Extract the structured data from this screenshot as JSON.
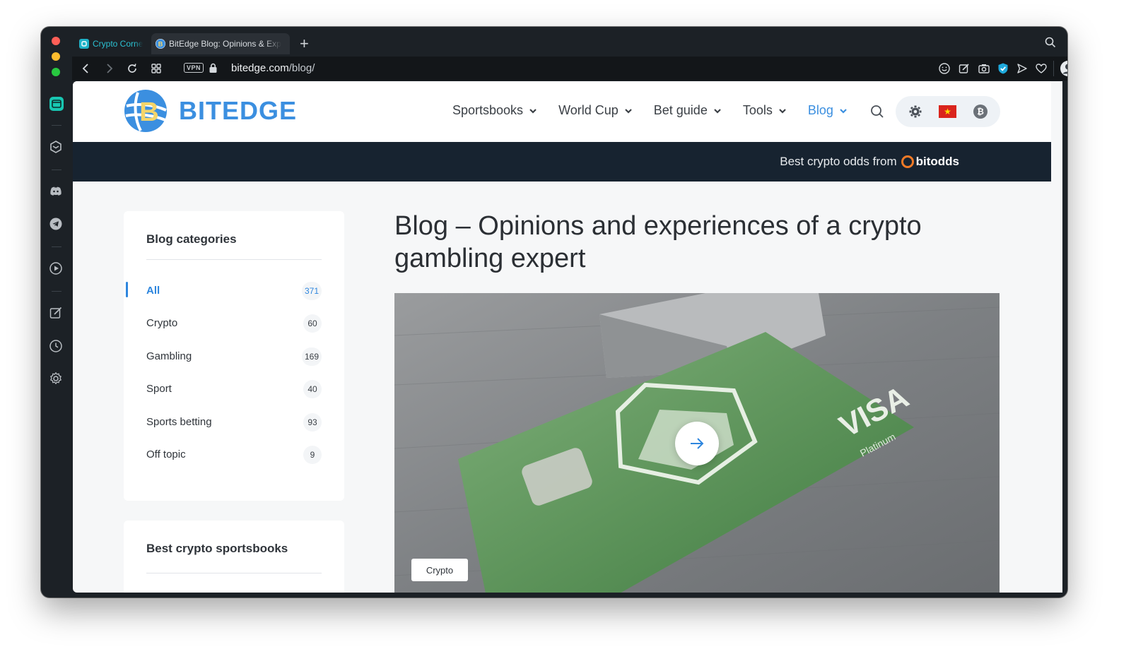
{
  "browser": {
    "tabs": [
      {
        "title": "Crypto Corne",
        "active": false
      },
      {
        "title": "BitEdge Blog: Opinions & Exp",
        "active": true
      }
    ],
    "new_tab": "+",
    "vpn_badge": "VPN",
    "url_host": "bitedge.com",
    "url_path": "/blog/",
    "sidebar_more": "•••"
  },
  "site": {
    "logo_text": "BITEDGE",
    "nav": [
      "Sportsbooks",
      "World Cup",
      "Bet guide",
      "Tools",
      "Blog"
    ],
    "active_nav": "Blog",
    "flag": "★",
    "btc": "₿",
    "promo_text": "Best crypto odds from",
    "promo_brand": "bitodds",
    "accent": "#3b8fe0",
    "promo_bg": "#172330"
  },
  "categories": {
    "title": "Blog categories",
    "items": [
      {
        "label": "All",
        "count": "371"
      },
      {
        "label": "Crypto",
        "count": "60"
      },
      {
        "label": "Gambling",
        "count": "169"
      },
      {
        "label": "Sport",
        "count": "40"
      },
      {
        "label": "Sports betting",
        "count": "93"
      },
      {
        "label": "Off topic",
        "count": "9"
      }
    ]
  },
  "best_sportsbooks": {
    "title": "Best crypto sportsbooks"
  },
  "main": {
    "page_title": "Blog – Opinions and experiences of a crypto gambling expert",
    "hero": {
      "tag": "Crypto",
      "card_text": "VISA",
      "card_sub": "Platinum"
    }
  }
}
